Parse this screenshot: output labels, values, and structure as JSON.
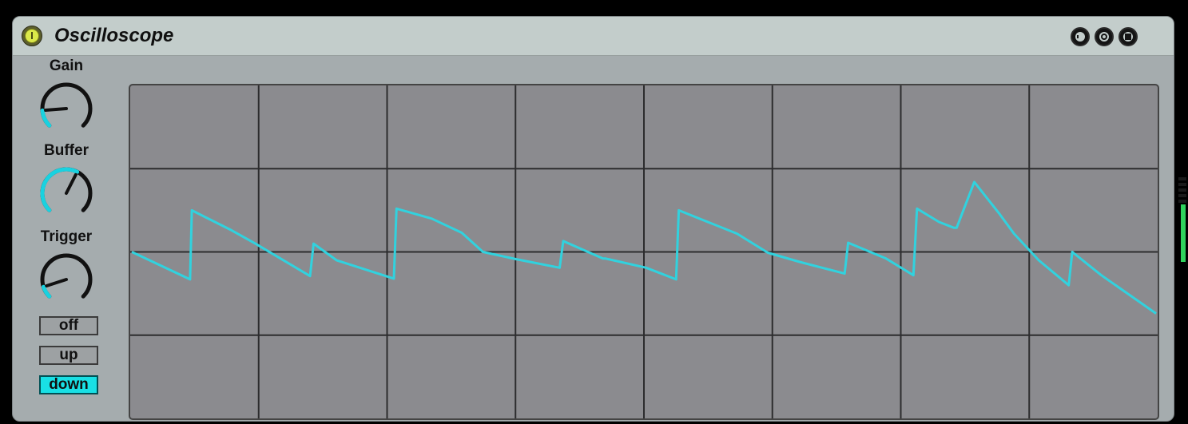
{
  "device": {
    "title": "Oscilloscope",
    "power_on": true,
    "title_buttons": [
      "hotswap-icon",
      "reset-icon",
      "save-icon"
    ]
  },
  "controls": {
    "gain": {
      "label": "Gain",
      "value": 0.15
    },
    "buffer": {
      "label": "Buffer",
      "value": 0.6
    },
    "trigger": {
      "label": "Trigger",
      "value": 0.1
    },
    "trigger_modes": [
      {
        "label": "off",
        "active": false
      },
      {
        "label": "up",
        "active": false
      },
      {
        "label": "down",
        "active": true
      }
    ]
  },
  "colors": {
    "waveform": "#31d2de",
    "accent": "#19e0e5",
    "grid": "#2c2c2e",
    "knob_arc": "#19d2e0",
    "meter": "#2fd35c"
  },
  "scope": {
    "grid_columns": 8,
    "grid_rows": 4,
    "waveform": [
      [
        0,
        0.0
      ],
      [
        0.066,
        0.33
      ],
      [
        0.068,
        -0.5
      ],
      [
        0.113,
        -0.26
      ],
      [
        0.14,
        -0.1
      ],
      [
        0.202,
        0.29
      ],
      [
        0.206,
        -0.1
      ],
      [
        0.232,
        0.1
      ],
      [
        0.297,
        0.32
      ],
      [
        0.3,
        -0.52
      ],
      [
        0.34,
        -0.4
      ],
      [
        0.374,
        -0.23
      ],
      [
        0.398,
        0.0
      ],
      [
        0.437,
        0.09
      ],
      [
        0.485,
        0.19
      ],
      [
        0.489,
        -0.13
      ],
      [
        0.534,
        0.08
      ],
      [
        0.537,
        0.08
      ],
      [
        0.583,
        0.19
      ],
      [
        0.617,
        0.33
      ],
      [
        0.62,
        -0.5
      ],
      [
        0.686,
        -0.22
      ],
      [
        0.721,
        0.01
      ],
      [
        0.757,
        0.12
      ],
      [
        0.808,
        0.26
      ],
      [
        0.812,
        -0.11
      ],
      [
        0.855,
        0.08
      ],
      [
        0.886,
        0.28
      ],
      [
        0.89,
        -0.52
      ],
      [
        0.915,
        -0.36
      ],
      [
        0.932,
        -0.29
      ],
      [
        0.935,
        -0.29
      ],
      [
        0.955,
        -0.84
      ],
      [
        0.984,
        -0.45
      ],
      [
        1.0,
        -0.22
      ],
      [
        1.028,
        0.1
      ],
      [
        1.062,
        0.4
      ],
      [
        1.066,
        0.0
      ],
      [
        1.099,
        0.28
      ],
      [
        1.161,
        0.74
      ]
    ]
  },
  "meter": {
    "level": 0.65
  }
}
